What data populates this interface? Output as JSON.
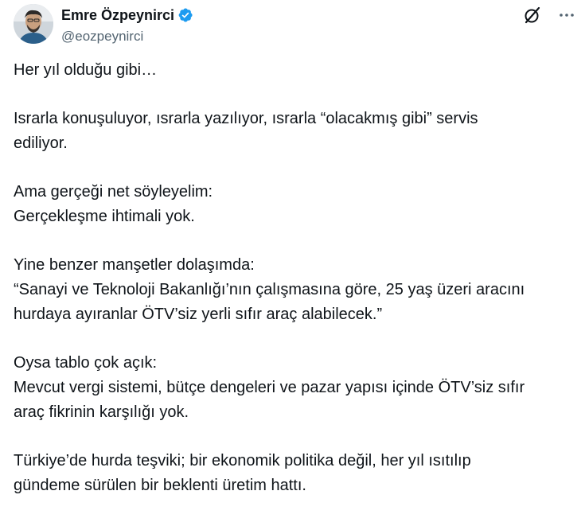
{
  "author": {
    "display_name": "Emre Özpeynirci",
    "handle": "@eozpeynirci",
    "verified_icon": "verified-badge-icon",
    "avatar_icon": "avatar"
  },
  "actions": {
    "grok_icon": "grok-icon",
    "more_icon": "more-icon"
  },
  "colors": {
    "text": "#0f1419",
    "secondary": "#536471",
    "verified": "#1d9bf0",
    "background": "#ffffff"
  },
  "paragraphs": [
    {
      "lines": [
        "Her yıl olduğu gibi…"
      ]
    },
    {
      "lines": [
        "Israrla konuşuluyor, ısrarla yazılıyor, ısrarla “olacakmış gibi” servis",
        "ediliyor."
      ]
    },
    {
      "lines": [
        "Ama gerçeği net söyleyelim:",
        "Gerçekleşme ihtimali yok."
      ]
    },
    {
      "lines": [
        "Yine benzer manşetler dolaşımda:",
        "“Sanayi ve Teknoloji Bakanlığı’nın çalışmasına göre, 25 yaş üzeri aracını",
        "hurdaya ayıranlar ÖTV’siz yerli sıfır araç alabilecek.”"
      ]
    },
    {
      "lines": [
        "Oysa tablo çok açık:",
        "Mevcut vergi sistemi, bütçe dengeleri ve pazar yapısı içinde ÖTV’siz sıfır",
        "araç fikrinin karşılığı yok."
      ]
    },
    {
      "lines": [
        "Türkiye’de hurda teşviki; bir ekonomik politika değil, her yıl ısıtılıp",
        "gündeme sürülen bir beklenti üretim hattı."
      ]
    }
  ]
}
